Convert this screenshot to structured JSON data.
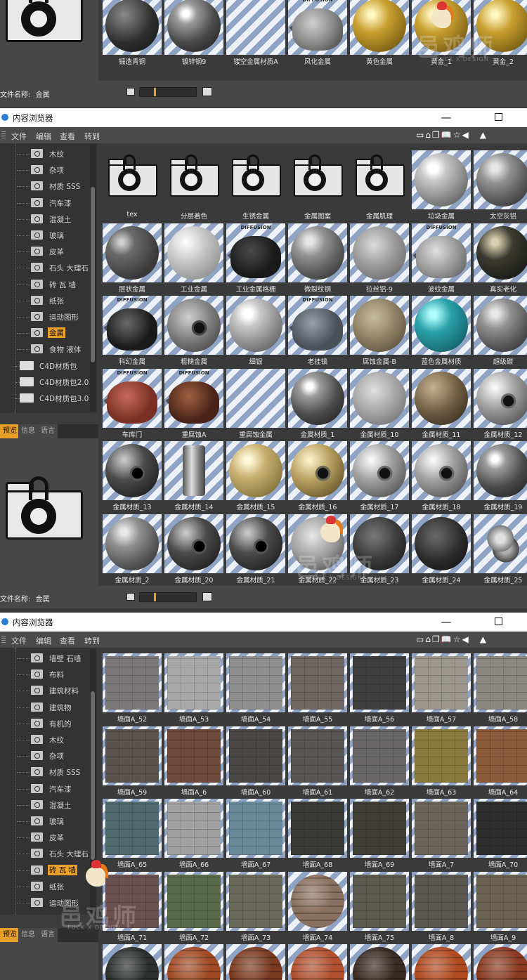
{
  "panel1": {
    "filename_label": "文件名称:",
    "filename_value": "金属",
    "tiles": [
      {
        "name": "锻造青铜",
        "look": "dark-sphere"
      },
      {
        "name": "镀锌钢9",
        "look": "chrome-sphere"
      },
      {
        "name": "镂空金属材质A",
        "look": "empty"
      },
      {
        "name": "风化金属",
        "look": "teapot-weathered"
      },
      {
        "name": "黄色金属",
        "look": "gold-sphere"
      },
      {
        "name": "黄金_1",
        "look": "gold-sphere"
      },
      {
        "name": "黄金_2",
        "look": "gold-sphere"
      }
    ]
  },
  "panel2": {
    "window_title": "内容浏览器",
    "menu": [
      "文件",
      "编辑",
      "查看",
      "转到"
    ],
    "tree": [
      "木纹",
      "杂项",
      "材质 SSS",
      "汽车漆",
      "混凝土",
      "玻璃",
      "皮革",
      "石头 大理石",
      "砖 瓦 墙",
      "纸张",
      "运动图形",
      "金属",
      "食物 液体"
    ],
    "selected_tree_item": "金属",
    "tree_roots": [
      "C4D材质包",
      "C4D材质包2.0",
      "C4D材质包3.0"
    ],
    "tabs": [
      "预览",
      "信息",
      "语言"
    ],
    "active_tab": "预览",
    "filename_label": "文件名称:",
    "filename_value": "金属",
    "folders": [
      "tex",
      "分层着色",
      "生锈金属",
      "金属图案",
      "金属肌理"
    ],
    "tiles": [
      {
        "name": "垃圾金属",
        "look": "silver-sphere"
      },
      {
        "name": "太空灰铝",
        "look": "steel-sphere"
      },
      {
        "name": "层状金属",
        "look": "dark-gray-sphere"
      },
      {
        "name": "工业金属",
        "look": "light-sphere"
      },
      {
        "name": "工业金属格栅",
        "look": "teapot-black"
      },
      {
        "name": "微裂纹钢",
        "look": "steel-sphere"
      },
      {
        "name": "拉丝铝-9",
        "look": "brushed-sphere"
      },
      {
        "name": "波纹金属",
        "look": "teapot-silver"
      },
      {
        "name": "真实老化",
        "look": "black-sphere"
      },
      {
        "name": "科幻金属",
        "look": "teapot-scifi"
      },
      {
        "name": "粗糙金属",
        "look": "rough-eye"
      },
      {
        "name": "细银",
        "look": "silver-sphere"
      },
      {
        "name": "老挂锁",
        "look": "teapot-old"
      },
      {
        "name": "腐蚀金属-B",
        "look": "corroded-sphere"
      },
      {
        "name": "蓝色金属材质",
        "look": "teal-sphere"
      },
      {
        "name": "超级碳",
        "look": "steel-sphere"
      },
      {
        "name": "车库门",
        "look": "teapot-red"
      },
      {
        "name": "重腐蚀A",
        "look": "teapot-rust"
      },
      {
        "name": "重腐蚀金属",
        "look": "empty"
      },
      {
        "name": "金属材质_1",
        "look": "chrome-sphere"
      },
      {
        "name": "金属材质_10",
        "look": "worn-sphere"
      },
      {
        "name": "金属材质_11",
        "look": "bronze-sphere"
      },
      {
        "name": "金属材质_12",
        "look": "eye-chrome"
      },
      {
        "name": "金属材质_13",
        "look": "eye-dark"
      },
      {
        "name": "金属材质_14",
        "look": "cylinder"
      },
      {
        "name": "金属材质_15",
        "look": "gold-pale-sphere"
      },
      {
        "name": "金属材质_16",
        "look": "eye-gold"
      },
      {
        "name": "金属材质_17",
        "look": "eye-chrome"
      },
      {
        "name": "金属材质_18",
        "look": "eye-chrome"
      },
      {
        "name": "金属材质_19",
        "look": "chrome-sphere"
      },
      {
        "name": "金属材质_2",
        "look": "steel-sphere"
      },
      {
        "name": "金属材质_20",
        "look": "eye-dark"
      },
      {
        "name": "金属材质_21",
        "look": "eye-dark"
      },
      {
        "name": "金属材质_22",
        "look": "marble-sphere"
      },
      {
        "name": "金属材质_23",
        "look": "dark-wrinkle"
      },
      {
        "name": "金属材质_24",
        "look": "dark-relief"
      },
      {
        "name": "金属材质_25",
        "look": "knot"
      }
    ]
  },
  "panel3": {
    "window_title": "内容浏览器",
    "menu": [
      "文件",
      "编辑",
      "查看",
      "转到"
    ],
    "tree": [
      "墙壁 石墙",
      "布料",
      "建筑材料",
      "建筑物",
      "有机的",
      "木纹",
      "杂项",
      "材质 SSS",
      "汽车漆",
      "混凝土",
      "玻璃",
      "皮革",
      "石头 大理石",
      "砖 瓦 墙",
      "纸张",
      "运动图形"
    ],
    "selected_tree_item": "砖 瓦 墙",
    "tabs": [
      "预览",
      "信息",
      "语言"
    ],
    "active_tab": "预览",
    "tiles": [
      {
        "name": "墙面A_52",
        "color": "#7a7878"
      },
      {
        "name": "墙面A_53",
        "color": "#a8a8a8"
      },
      {
        "name": "墙面A_54",
        "color": "#8e8e8e"
      },
      {
        "name": "墙面A_55",
        "color": "#6e6762"
      },
      {
        "name": "墙面A_56",
        "color": "#3e3e3e"
      },
      {
        "name": "墙面A_57",
        "color": "#9a968e"
      },
      {
        "name": "墙面A_58",
        "color": "#8a8680"
      },
      {
        "name": "墙面A_59",
        "color": "#5a5450"
      },
      {
        "name": "墙面A_6",
        "color": "#6e4a3a"
      },
      {
        "name": "墙面A_60",
        "color": "#4a4846"
      },
      {
        "name": "墙面A_61",
        "color": "#585654"
      },
      {
        "name": "墙面A_62",
        "color": "#686666"
      },
      {
        "name": "墙面A_63",
        "color": "#8a7a3e"
      },
      {
        "name": "墙面A_64",
        "color": "#8a5a3a"
      },
      {
        "name": "墙面A_65",
        "color": "#4e6a6e"
      },
      {
        "name": "墙面A_66",
        "color": "#a0a0a0"
      },
      {
        "name": "墙面A_67",
        "color": "#6a8a9a"
      },
      {
        "name": "墙面A_68",
        "color": "#3a3a36"
      },
      {
        "name": "墙面A_69",
        "color": "#3e3e36"
      },
      {
        "name": "墙面A_7",
        "color": "#6a645a"
      },
      {
        "name": "墙面A_70",
        "color": "#2e2e2e"
      },
      {
        "name": "墙面A_71",
        "color": "#6a5050"
      },
      {
        "name": "墙面A_72",
        "color": "#5a6a48"
      },
      {
        "name": "墙面A_73",
        "color": "#6a6a5a"
      },
      {
        "name": "墙面A_74",
        "color": "#8a7060",
        "round": true
      },
      {
        "name": "墙面A_75",
        "color": "#5a5a50"
      },
      {
        "name": "墙面A_8",
        "color": "#5a5650"
      },
      {
        "name": "墙面A_9",
        "color": "#6a6250"
      },
      {
        "name": "",
        "color": "#2e3030",
        "round": true
      },
      {
        "name": "",
        "color": "#a04a24",
        "round": true
      },
      {
        "name": "",
        "color": "#7a3a20",
        "round": true
      },
      {
        "name": "",
        "color": "#b05030",
        "round": true
      },
      {
        "name": "",
        "color": "#3a2a24",
        "round": true
      },
      {
        "name": "",
        "color": "#b04a20",
        "round": true
      },
      {
        "name": "",
        "color": "#8a3a20",
        "round": true
      }
    ]
  },
  "watermark": {
    "text": "邑鸡师",
    "sub": "FUCK X DESIGN"
  },
  "colors": {
    "accent": "#e8a028",
    "panel": "#3c3c3c",
    "checker_blue": "#8fa4c5",
    "checker_white": "#eef2f8"
  }
}
